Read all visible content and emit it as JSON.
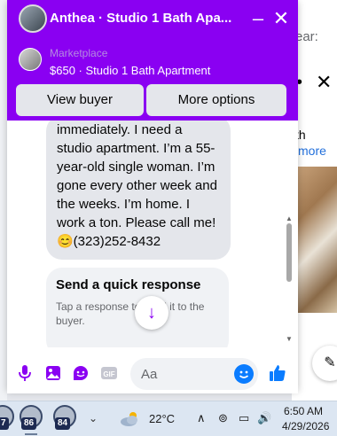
{
  "background": {
    "right_label": "ear:",
    "right_text1": "th",
    "right_more": "more"
  },
  "chat": {
    "title": "Anthea · Studio 1 Bath Apa...",
    "listing": {
      "source": "Marketplace",
      "price_title": "$650 · Studio 1 Bath Apartment"
    },
    "actions": {
      "view_buyer": "View buyer",
      "more_options": "More options"
    },
    "message_text": "immediately. I need a studio apartment. I’m a 55-year-old single woman. I’m gone every other week and the weeks. I’m home. I work a ton. Please call me! 😊(323)252-8432",
    "quick_response": {
      "title": "Send a quick response",
      "body": "Tap a response to send it to the buyer."
    },
    "composer": {
      "placeholder": "Aa"
    },
    "accent_color": "#8a00f2"
  },
  "taskbar": {
    "apps": [
      {
        "badge": "7"
      },
      {
        "badge": "86"
      },
      {
        "badge": "84"
      }
    ],
    "temperature": "22°C",
    "time": "6:50 AM",
    "date": "4/29/2026"
  }
}
